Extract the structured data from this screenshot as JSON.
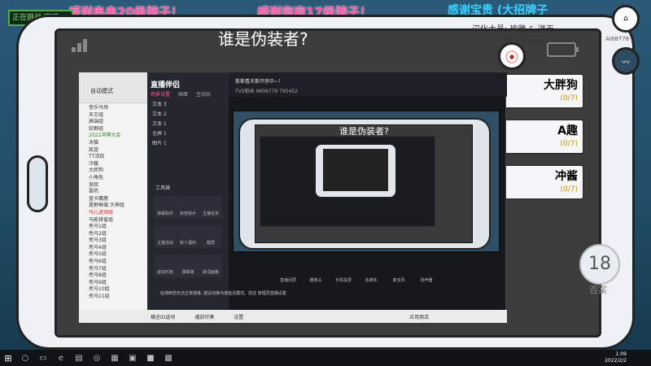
{
  "stream": {
    "marquee_1": "感谢冉冉20级牌子！",
    "marquee_2": "感谢宿宿17级牌子！",
    "top_right": "感谢宝贵 (大招牌子",
    "bot_badge": "正在挑战 喵喵",
    "hint_line": "汉化大员: 瑜雅 & 洋天",
    "hint_ping": "P 75 ms",
    "id_label": "AI88778"
  },
  "game": {
    "title": "谁是伪装者?",
    "players": [
      {
        "name": "大胖狗",
        "score": "(0/7)"
      },
      {
        "name": "A趣",
        "score": "(0/7)"
      },
      {
        "name": "冲酱",
        "score": "(0/7)"
      }
    ],
    "timer": "18",
    "timer_label": "否案"
  },
  "app": {
    "logo": "直播伴侣",
    "room_name": "快乐马场",
    "top_title": "斯斯看天斯开房中~！",
    "top_stats": "TV5粉丝  9606779  795452",
    "tabs": [
      {
        "label": "场景设置",
        "active": true
      },
      {
        "label": "画面",
        "active": false
      },
      {
        "label": "互动玩",
        "active": false
      }
    ],
    "sources": [
      "文本 3",
      "文本 2",
      "文本 1",
      "全屏 1",
      "图片 1"
    ],
    "tools_label": "工具箱",
    "tools": [
      "弹幕助手",
      "房管助手",
      "主播任务",
      "主播活动",
      "新人福利",
      "截屏",
      "虚拟形象",
      "弹幕墙",
      "歌词面板"
    ],
    "left_header": "自动模式",
    "left_items": [
      {
        "text": "音乐马场",
        "type": "normal"
      },
      {
        "text": "天王组",
        "type": "normal"
      },
      {
        "text": "高端组",
        "type": "normal"
      },
      {
        "text": "狂野组",
        "type": "normal"
      },
      {
        "text": "2022冲牌大会",
        "type": "green"
      },
      {
        "text": "冰猫",
        "type": "normal"
      },
      {
        "text": "凯旋",
        "type": "normal"
      },
      {
        "text": "TT活跃",
        "type": "normal"
      },
      {
        "text": "冷暖",
        "type": "normal"
      },
      {
        "text": "大胖狗",
        "type": "normal"
      },
      {
        "text": "小角色",
        "type": "normal"
      },
      {
        "text": "渐叔",
        "type": "normal"
      },
      {
        "text": "翠药",
        "type": "normal"
      },
      {
        "text": "蓝卡麋鹿",
        "type": "normal"
      },
      {
        "text": "夏野琳璃 大神组",
        "type": "normal"
      },
      {
        "text": "马儿进测组",
        "type": "red"
      },
      {
        "text": "马能排雀组",
        "type": "normal"
      },
      {
        "text": "秃马1组",
        "type": "normal"
      },
      {
        "text": "秃马2组",
        "type": "normal"
      },
      {
        "text": "秃马3组",
        "type": "normal"
      },
      {
        "text": "秃马4组",
        "type": "normal"
      },
      {
        "text": "秃马5组",
        "type": "normal"
      },
      {
        "text": "秃马6组",
        "type": "normal"
      },
      {
        "text": "秃马7组",
        "type": "normal"
      },
      {
        "text": "秃马8组",
        "type": "normal"
      },
      {
        "text": "秃马9组",
        "type": "normal"
      },
      {
        "text": "秃马10组",
        "type": "normal"
      },
      {
        "text": "秃马11组",
        "type": "normal"
      }
    ],
    "bottom_buttons": [
      "直播间屏",
      "摄像头",
      "手机投屏",
      "多媒体",
      "麦克风",
      "扬声器"
    ],
    "notice": "检测到您无法正常连接, 建议切换为低延迟模式。前往 管理员直播设置",
    "status": [
      "横坐ID选项",
      "播放伴奏",
      "设置",
      "应用商店"
    ]
  },
  "taskbar": {
    "time": "1:09",
    "date": "2022/2/2"
  }
}
